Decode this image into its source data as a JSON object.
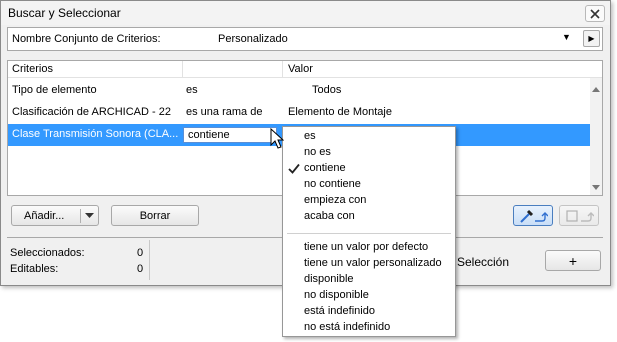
{
  "window": {
    "title": "Buscar y Seleccionar"
  },
  "criteria_set": {
    "label": "Nombre Conjunto de Criterios:",
    "value": "Personalizado"
  },
  "grid": {
    "headers": {
      "criterios": "Criterios",
      "valor": "Valor"
    },
    "rows": [
      {
        "criterio": "Tipo de elemento",
        "operador": "es",
        "valor": "Todos"
      },
      {
        "criterio": "Clasificación de ARCHICAD - 22",
        "operador": "es una rama de",
        "valor": "Elemento de Montaje"
      },
      {
        "criterio": "Clase Transmisión Sonora (CLA...",
        "operador": "contiene",
        "valor": ""
      }
    ]
  },
  "buttons": {
    "add": "Añadir...",
    "delete": "Borrar",
    "plus": "+"
  },
  "status": {
    "selected_label": "Seleccionados:",
    "selected_value": "0",
    "editable_label": "Editables:",
    "editable_value": "0",
    "selection_text": "Selección"
  },
  "dropdown": {
    "items_a": [
      "es",
      "no es",
      "contiene",
      "no contiene",
      "empieza con",
      "acaba con"
    ],
    "items_b": [
      "tiene un valor por defecto",
      "tiene un valor personalizado",
      "disponible",
      "no disponible",
      "está indefinido",
      "no está indefinido"
    ],
    "checked": "contiene"
  },
  "colors": {
    "selection": "#3399ff",
    "accent": "#2f6fd0"
  },
  "icons": [
    "close-icon",
    "chevron-down-icon",
    "play-icon",
    "eyedropper-icon",
    "select-frame-icon",
    "mouse-cursor-icon",
    "checkmark-icon"
  ]
}
